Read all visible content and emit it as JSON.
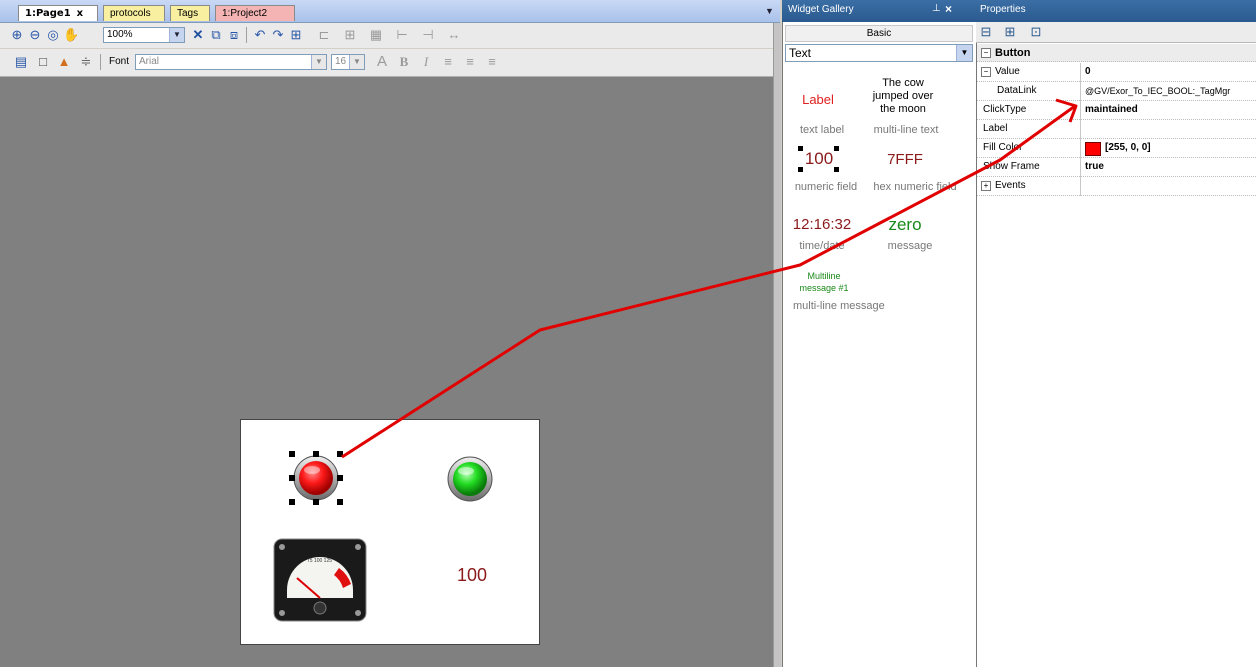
{
  "tabs": {
    "page1": "1:Page1",
    "protocols": "protocols",
    "tags": "Tags",
    "project2": "1:Project2",
    "close_glyph": "x"
  },
  "toolbar": {
    "zoom_value": "100%",
    "font_label": "Font",
    "font_value": "Arial",
    "font_size_value": "16"
  },
  "canvas": {
    "numeric_value": "100",
    "gauge_scale": "75 100 125"
  },
  "widget_gallery": {
    "title": "Widget Gallery",
    "pin_glyph": "⊥",
    "close_glyph": "×",
    "category_button": "Basic",
    "selected_type": "Text",
    "items": [
      {
        "preview": "Label",
        "caption": "text label"
      },
      {
        "preview_lines": [
          "The cow",
          "jumped over",
          "the moon"
        ],
        "caption": "multi-line text"
      },
      {
        "preview": "100",
        "caption": "numeric field"
      },
      {
        "preview": "7FFF",
        "caption": "hex numeric field"
      },
      {
        "preview": "12:16:32",
        "caption": "time/date"
      },
      {
        "preview": "zero",
        "caption": "message"
      },
      {
        "preview_lines": [
          "Multiline",
          "message #1"
        ],
        "caption": "multi-line message"
      }
    ]
  },
  "properties": {
    "title": "Properties",
    "section": "Button",
    "rows": [
      {
        "name": "Value",
        "value": "0"
      },
      {
        "name": "DataLink",
        "value": "@GV/Exor_To_IEC_BOOL:_TagMgr"
      },
      {
        "name": "ClickType",
        "value": "maintained"
      },
      {
        "name": "Label",
        "value": ""
      },
      {
        "name": "Fill Color",
        "value": "[255, 0, 0]",
        "swatch": "#ff0000"
      },
      {
        "name": "Show Frame",
        "value": "true"
      },
      {
        "name": "Events",
        "value": ""
      }
    ]
  },
  "colors": {
    "canvas_bg": "#808080",
    "panel_title": "#2b5a8f",
    "annotation_arrow": "#e00000",
    "led_red": "#ff1a1a",
    "led_green": "#22dd22",
    "numeric_text": "#8b1a1a"
  },
  "icons": [
    "zoom-in-icon",
    "zoom-out-icon",
    "zoom-fit-icon",
    "pan-hand-icon",
    "delete-icon",
    "copy-icon",
    "paste-icon",
    "rotate-left-icon",
    "rotate-right-icon",
    "group-icon",
    "align-icon",
    "grid-icon",
    "spacing-icon",
    "font-color-icon",
    "bold-icon",
    "italic-icon",
    "align-left-icon",
    "align-center-icon",
    "align-right-icon"
  ]
}
